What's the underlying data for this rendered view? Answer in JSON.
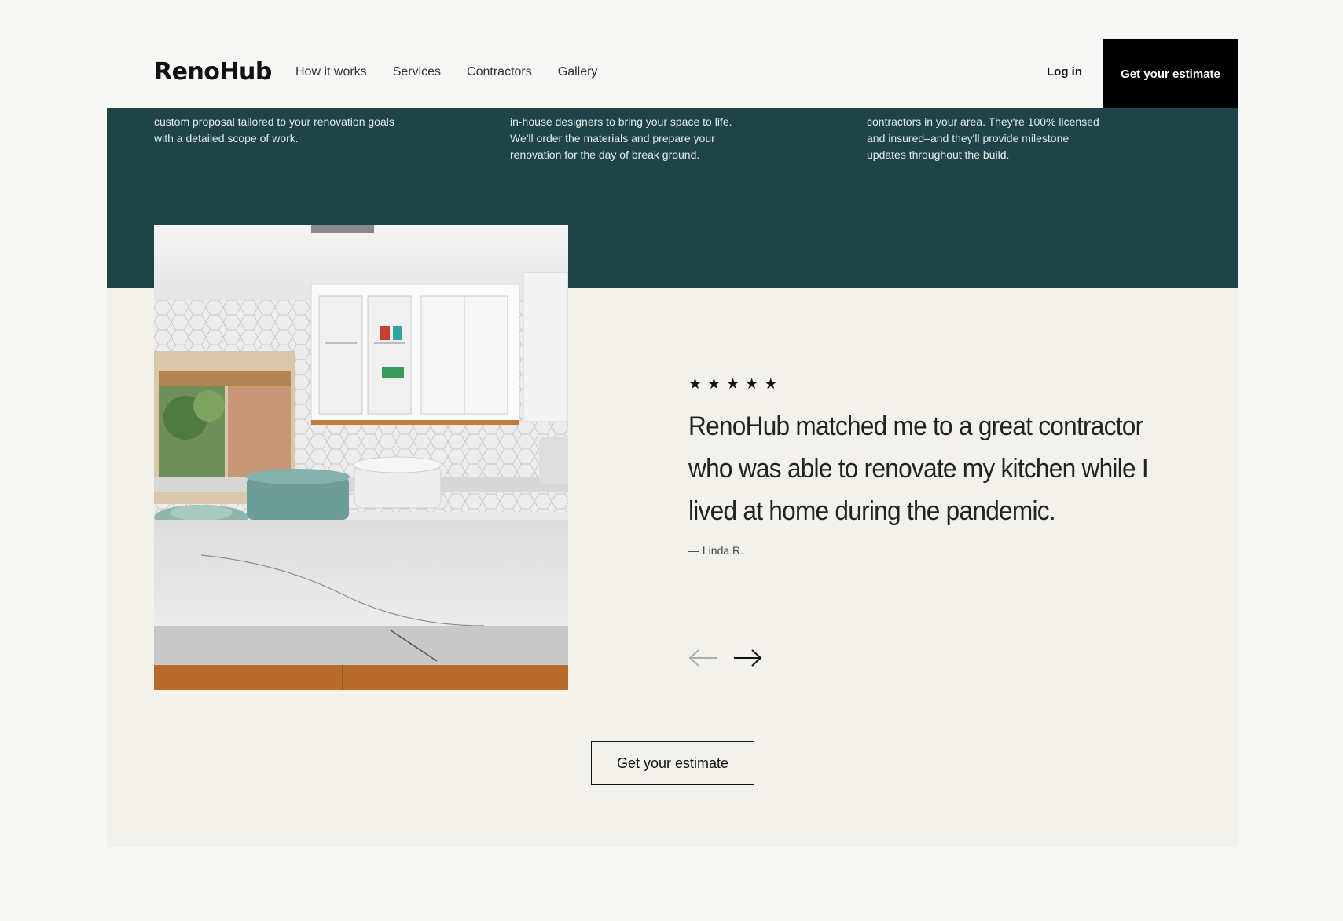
{
  "brand": {
    "logo": "RenoHub"
  },
  "nav": {
    "items": [
      {
        "label": "How it works"
      },
      {
        "label": "Services"
      },
      {
        "label": "Contractors"
      },
      {
        "label": "Gallery"
      }
    ],
    "login_label": "Log in",
    "cta_label": "Get your estimate"
  },
  "features": [
    {
      "text": "custom proposal tailored to your renovation goals with a detailed scope of work."
    },
    {
      "text": "in-house designers to bring your space to life. We'll order the materials and prepare your renovation for the day of break ground."
    },
    {
      "text": "contractors in your area. They're 100% licensed and insured–and they'll provide milestone updates throughout the build."
    }
  ],
  "testimonial": {
    "rating": 5,
    "stars": [
      "★",
      "★",
      "★",
      "★",
      "★"
    ],
    "quote": "RenoHub matched me to a great contractor who was able to renovate my kitchen while I lived at home during the pandemic.",
    "author": "— Linda R."
  },
  "carousel": {
    "prev_icon": "arrow-left-icon",
    "next_icon": "arrow-right-icon"
  },
  "cta_bottom_label": "Get your estimate",
  "colors": {
    "band": "#1e4447",
    "background": "#f7f7f5",
    "section": "#f2f1ec",
    "cta": "#000000"
  }
}
